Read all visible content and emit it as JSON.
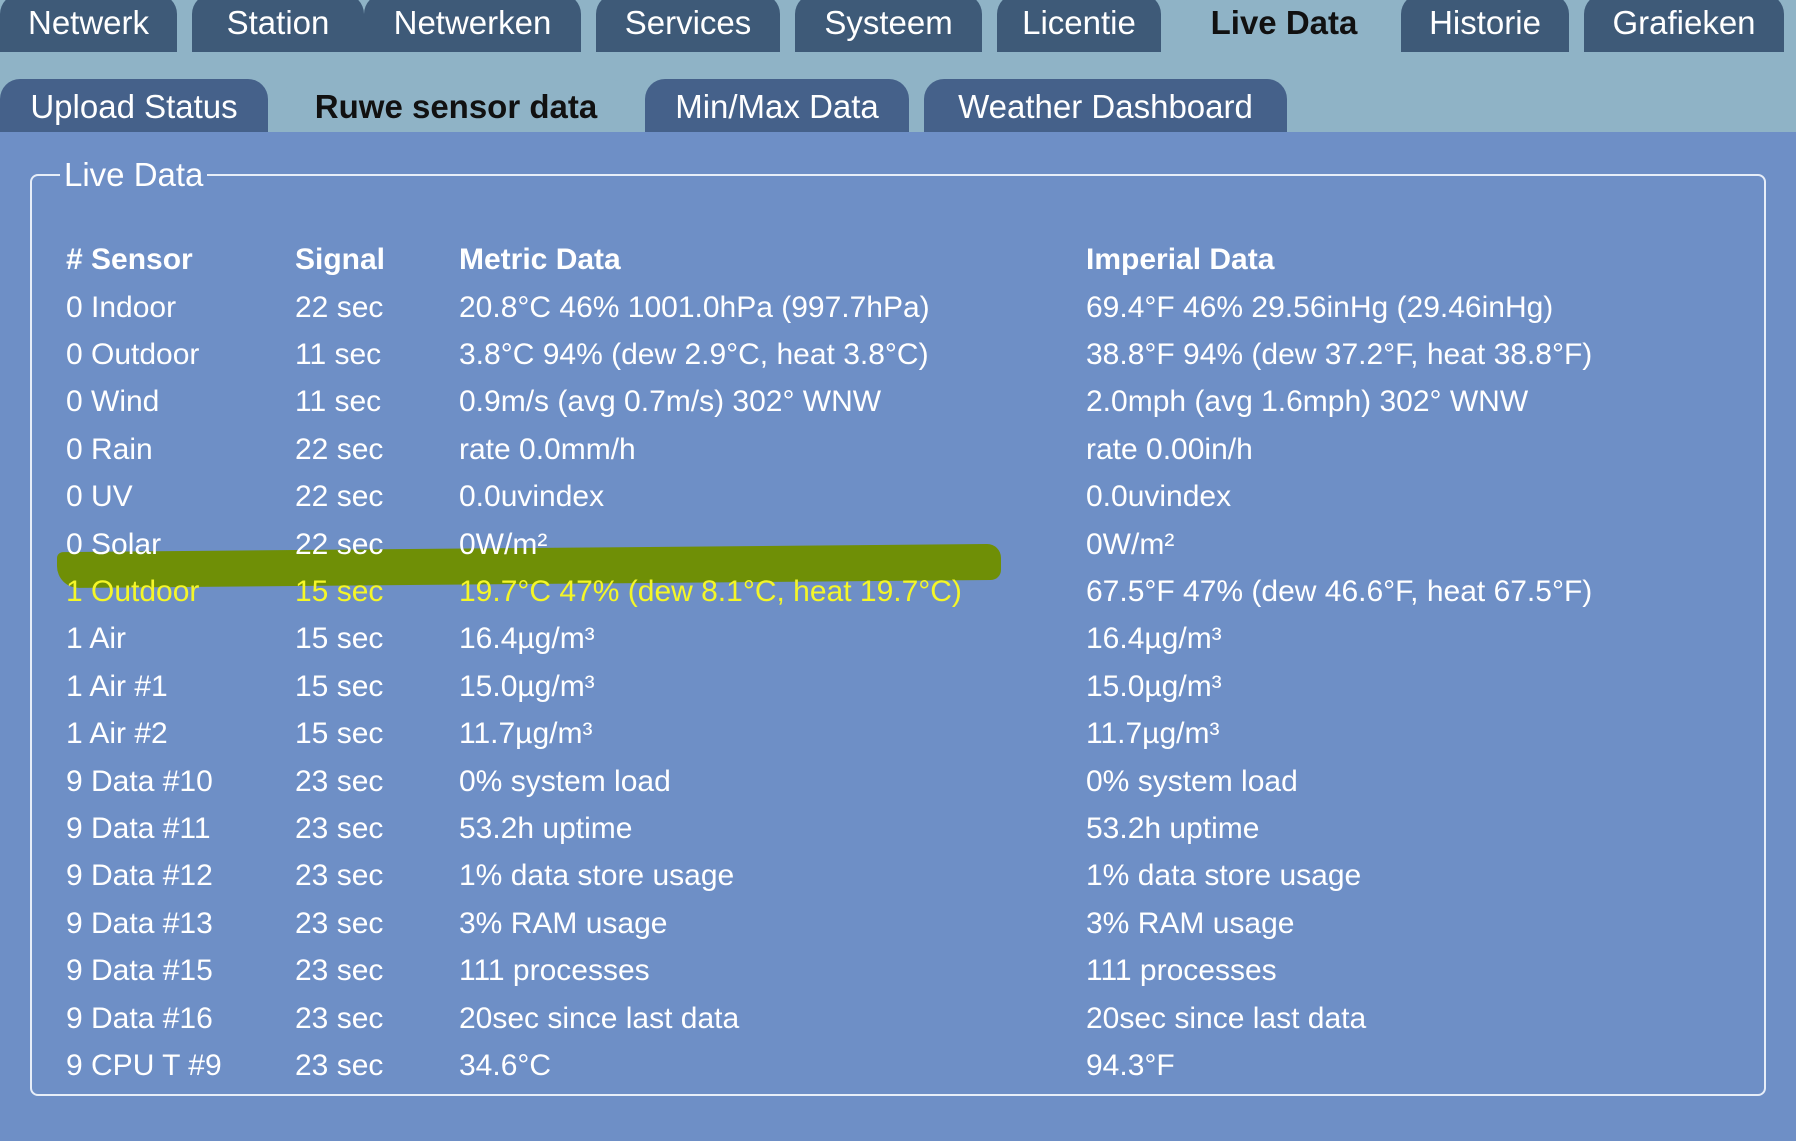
{
  "main_tabs": [
    {
      "label": "Netwerk",
      "active": false
    },
    {
      "label": "Station",
      "active": false
    },
    {
      "label": "Netwerken",
      "active": false
    },
    {
      "label": "Services",
      "active": false
    },
    {
      "label": "Systeem",
      "active": false
    },
    {
      "label": "Licentie",
      "active": false
    },
    {
      "label": "Live Data",
      "active": true
    },
    {
      "label": "Historie",
      "active": false
    },
    {
      "label": "Grafieken",
      "active": false
    }
  ],
  "sub_tabs": [
    {
      "label": "Upload Status",
      "active": false
    },
    {
      "label": "Ruwe sensor data",
      "active": true
    },
    {
      "label": "Min/Max Data",
      "active": false
    },
    {
      "label": "Weather Dashboard",
      "active": false
    }
  ],
  "panel": {
    "legend": "Live Data",
    "headers": {
      "sensor": "# Sensor",
      "signal": "Signal",
      "metric": "Metric Data",
      "imperial": "Imperial Data"
    },
    "rows": [
      {
        "sensor": "0 Indoor",
        "signal": "22 sec",
        "metric": "20.8°C 46% 1001.0hPa (997.7hPa)",
        "imperial": "69.4°F 46% 29.56inHg (29.46inHg)"
      },
      {
        "sensor": "0 Outdoor",
        "signal": "11 sec",
        "metric": "3.8°C 94% (dew 2.9°C, heat 3.8°C)",
        "imperial": "38.8°F 94% (dew 37.2°F, heat 38.8°F)"
      },
      {
        "sensor": "0 Wind",
        "signal": "11 sec",
        "metric": "0.9m/s (avg 0.7m/s) 302° WNW",
        "imperial": "2.0mph (avg 1.6mph) 302° WNW"
      },
      {
        "sensor": "0 Rain",
        "signal": "22 sec",
        "metric": "rate 0.0mm/h",
        "imperial": "rate 0.00in/h"
      },
      {
        "sensor": "0 UV",
        "signal": "22 sec",
        "metric": "0.0uvindex",
        "imperial": "0.0uvindex"
      },
      {
        "sensor": "0 Solar",
        "signal": "22 sec",
        "metric": "0W/m²",
        "imperial": "0W/m²"
      },
      {
        "sensor": "1 Outdoor",
        "signal": "15 sec",
        "metric": "19.7°C 47% (dew 8.1°C, heat 19.7°C)",
        "imperial": "67.5°F 47% (dew 46.6°F, heat 67.5°F)"
      },
      {
        "sensor": "1 Air",
        "signal": "15 sec",
        "metric": "16.4µg/m³",
        "imperial": "16.4µg/m³"
      },
      {
        "sensor": "1 Air #1",
        "signal": "15 sec",
        "metric": "15.0µg/m³",
        "imperial": "15.0µg/m³"
      },
      {
        "sensor": "1 Air #2",
        "signal": "15 sec",
        "metric": "11.7µg/m³",
        "imperial": "11.7µg/m³"
      },
      {
        "sensor": "9 Data #10",
        "signal": "23 sec",
        "metric": "0% system load",
        "imperial": "0% system load"
      },
      {
        "sensor": "9 Data #11",
        "signal": "23 sec",
        "metric": "53.2h uptime",
        "imperial": "53.2h uptime"
      },
      {
        "sensor": "9 Data #12",
        "signal": "23 sec",
        "metric": "1% data store usage",
        "imperial": "1% data store usage"
      },
      {
        "sensor": "9 Data #13",
        "signal": "23 sec",
        "metric": "3% RAM usage",
        "imperial": "3% RAM usage"
      },
      {
        "sensor": "9 Data #15",
        "signal": "23 sec",
        "metric": "111 processes",
        "imperial": "111 processes"
      },
      {
        "sensor": "9 Data #16",
        "signal": "23 sec",
        "metric": "20sec since last data",
        "imperial": "20sec since last data"
      },
      {
        "sensor": "9 CPU T #9",
        "signal": "23 sec",
        "metric": "34.6°C",
        "imperial": "94.3°F"
      }
    ]
  },
  "colors": {
    "background": "#6e8fc6",
    "tab_bar": "#8fb3c6",
    "tab_inactive": "#3e5a78",
    "highlight_marker": "#6f8f06",
    "highlight_text": "#f4f628"
  }
}
